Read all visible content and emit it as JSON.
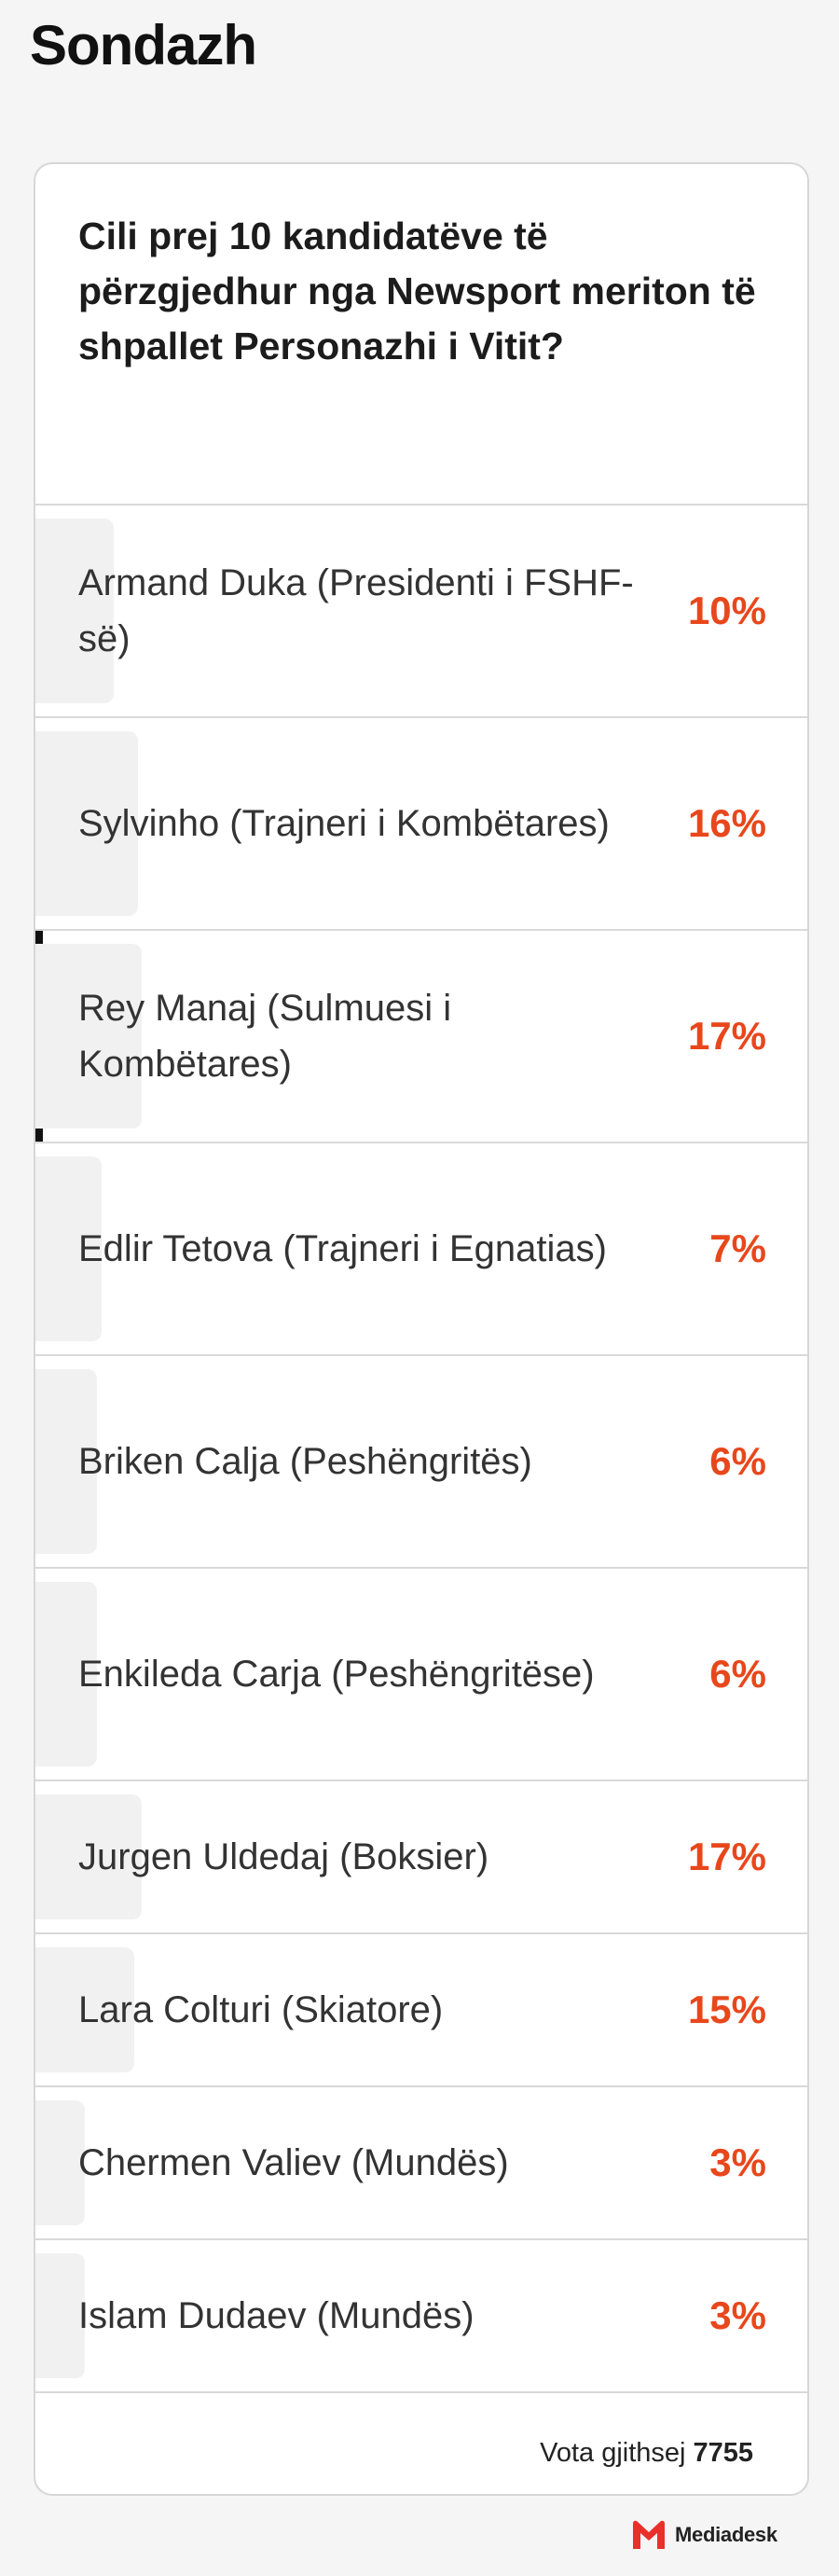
{
  "page_title": "Sondazh",
  "poll": {
    "question": "Cili prej 10 kandidatëve të përzgjedhur nga Newsport meriton të shpallet Personazhi i Vitit?",
    "options": [
      {
        "label": "Armand Duka (Presidenti i FSHF-së)",
        "percent": "10%",
        "share": 0.1,
        "selected": false
      },
      {
        "label": "Sylvinho (Trajneri i Kombëtares)",
        "percent": "16%",
        "share": 0.16,
        "selected": false
      },
      {
        "label": "Rey Manaj (Sulmuesi i Kombëtares)",
        "percent": "17%",
        "share": 0.17,
        "selected": true
      },
      {
        "label": "Edlir Tetova (Trajneri i Egnatias)",
        "percent": "7%",
        "share": 0.07,
        "selected": false
      },
      {
        "label": "Briken Calja (Peshëngritës)",
        "percent": "6%",
        "share": 0.06,
        "selected": false
      },
      {
        "label": "Enkileda Carja (Peshëngritëse)",
        "percent": "6%",
        "share": 0.06,
        "selected": false
      },
      {
        "label": "Jurgen Uldedaj (Boksier)",
        "percent": "17%",
        "share": 0.17,
        "selected": false
      },
      {
        "label": "Lara Colturi (Skiatore)",
        "percent": "15%",
        "share": 0.15,
        "selected": false
      },
      {
        "label": "Chermen Valiev (Mundës)",
        "percent": "3%",
        "share": 0.03,
        "selected": false
      },
      {
        "label": "Islam Dudaev (Mundës)",
        "percent": "3%",
        "share": 0.03,
        "selected": false
      }
    ],
    "total_label": "Vota gjithsej",
    "total_value": "7755"
  },
  "brand": {
    "name": "Mediadesk",
    "icon": "mediadesk-logo-icon",
    "color": "#e8312a"
  },
  "colors": {
    "percent": "#e8471c",
    "accent": "#111111",
    "fill": "#f1f1f1"
  }
}
